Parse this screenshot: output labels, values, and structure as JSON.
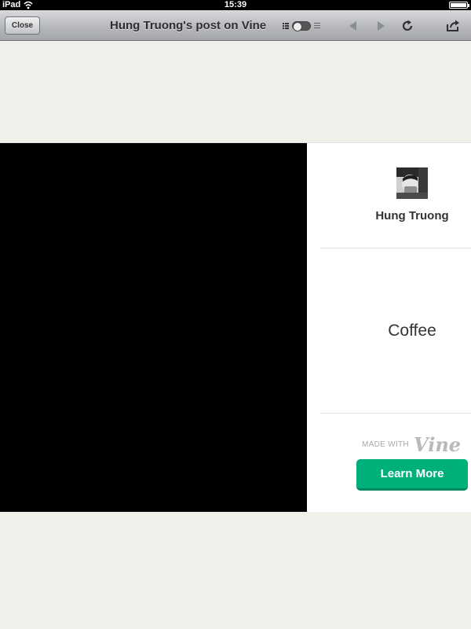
{
  "status_bar": {
    "carrier": "iPad",
    "time": "15:39"
  },
  "toolbar": {
    "close_label": "Close",
    "title": "Hung Truong's post on Vine"
  },
  "post": {
    "author": "Hung Truong",
    "caption": "Coffee"
  },
  "branding": {
    "made_with": "MADE WITH",
    "logo_text": "Vine"
  },
  "cta": {
    "label": "Learn More"
  },
  "colors": {
    "page_bg": "#f0f0eb",
    "cta_green": "#00b07a",
    "video_bg": "#000000"
  }
}
